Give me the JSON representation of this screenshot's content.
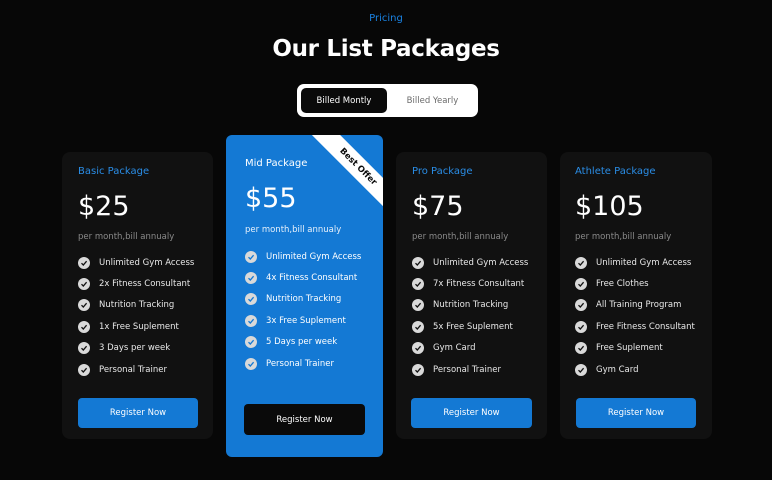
{
  "header": {
    "eyebrow": "Pricing",
    "title": "Our List Packages"
  },
  "billing_toggle": {
    "monthly_label": "Billed Montly",
    "yearly_label": "Billed Yearly",
    "selected": "monthly"
  },
  "colors": {
    "accent": "#1479d4",
    "background": "#070707",
    "card": "#111111"
  },
  "packages": [
    {
      "name": "Basic Package",
      "price": "$25",
      "period": "per month,bill annualy",
      "features": [
        "Unlimited Gym Access",
        "2x Fitness Consultant",
        "Nutrition Tracking",
        "1x Free Suplement",
        "3 Days per week",
        "Personal Trainer"
      ],
      "cta": "Register Now"
    },
    {
      "name": "Mid Package",
      "price": "$55",
      "period": "per month,bill annualy",
      "badge": "Best Offer",
      "features": [
        "Unlimited Gym Access",
        "4x Fitness Consultant",
        "Nutrition Tracking",
        "3x Free Suplement",
        "5 Days per week",
        "Personal Trainer"
      ],
      "cta": "Register Now"
    },
    {
      "name": "Pro Package",
      "price": "$75",
      "period": "per month,bill annualy",
      "features": [
        "Unlimited Gym Access",
        "7x Fitness Consultant",
        "Nutrition Tracking",
        "5x Free Suplement",
        "Gym Card",
        "Personal Trainer"
      ],
      "cta": "Register Now"
    },
    {
      "name": "Athlete Package",
      "price": "$105",
      "period": "per month,bill annualy",
      "features": [
        "Unlimited Gym Access",
        "Free Clothes",
        "All Training Program",
        "Free Fitness Consultant",
        "Free Suplement",
        "Gym Card"
      ],
      "cta": "Register Now"
    }
  ]
}
